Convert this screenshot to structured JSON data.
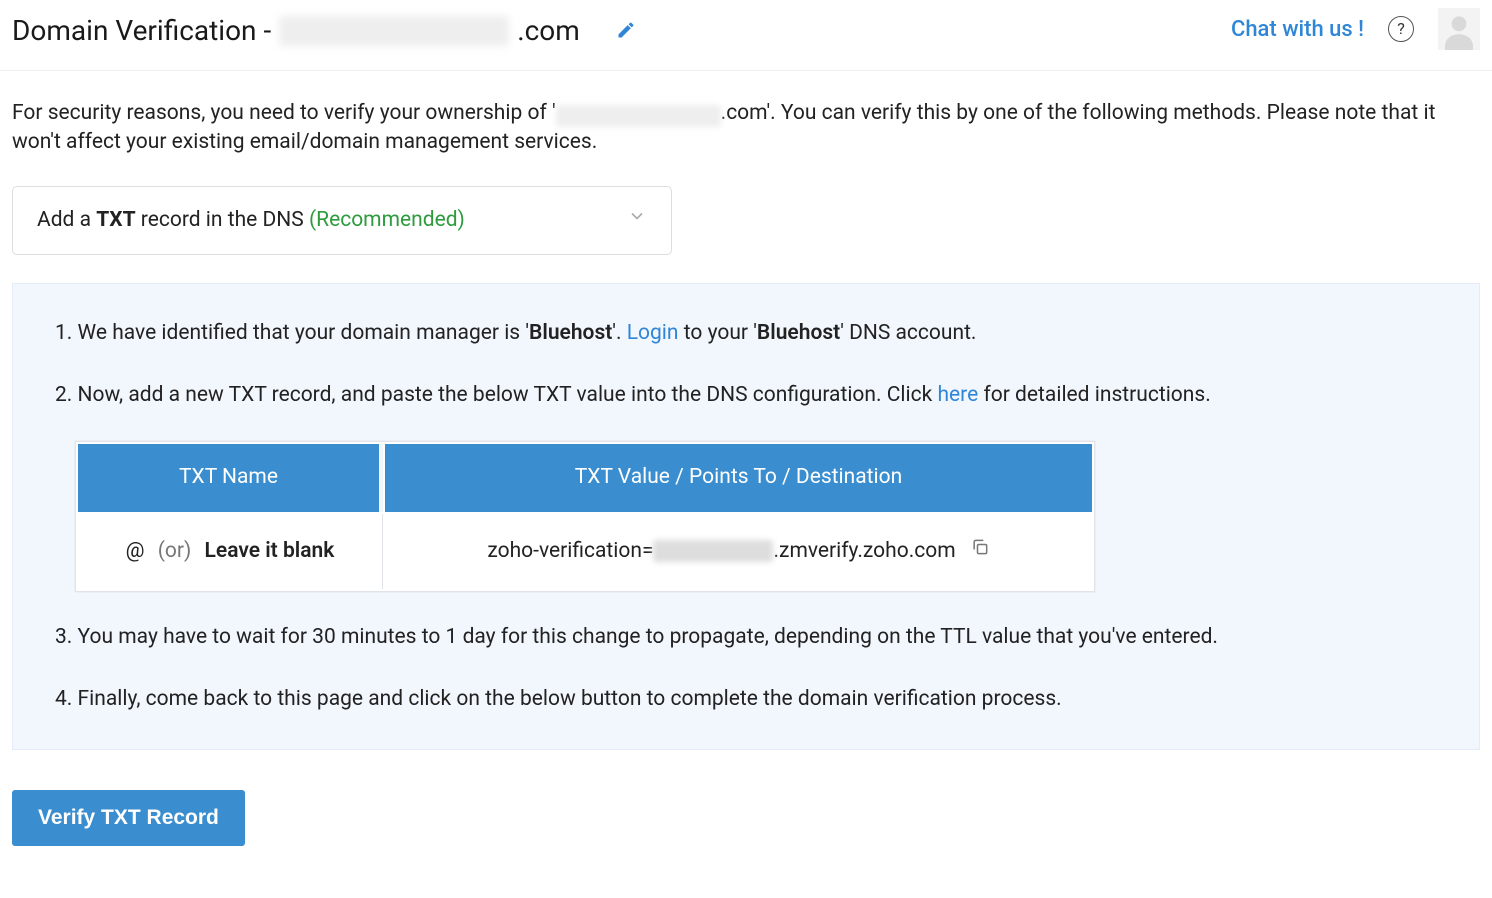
{
  "header": {
    "title_prefix": "Domain Verification - ",
    "domain_redacted": true,
    "title_suffix": ".com",
    "chat_link": "Chat with us !"
  },
  "description": {
    "pre": "For security reasons, you need to verify your ownership of '",
    "mid_redacted": true,
    "post1": ".com'. You can verify this by one of the following methods. Please note that it won't affect your existing email/domain management services."
  },
  "method": {
    "label_pre": "Add a ",
    "label_bold": "TXT",
    "label_post": " record in the DNS ",
    "recommended": "(Recommended)"
  },
  "steps": {
    "s1_pre": "1. We have identified that your domain manager is '",
    "s1_bluehost": "Bluehost",
    "s1_mid": "'. ",
    "s1_login": "Login",
    "s1_post": " to your '",
    "s1_bluehost2": "Bluehost",
    "s1_end": "' DNS account.",
    "s2_pre": "2. Now, add a new TXT record, and paste the below TXT value into the DNS configuration. Click ",
    "s2_here": "here",
    "s2_post": " for detailed instructions.",
    "s3": "3. You may have to wait for 30 minutes to 1 day for this change to propagate, depending on the TTL value that you've entered.",
    "s4": "4. Finally, come back to this page and click on the below button to complete the domain verification process."
  },
  "table": {
    "col1": "TXT Name",
    "col2": "TXT Value / Points To / Destination",
    "name_at": "@",
    "name_or": "(or)",
    "name_blank": "Leave it blank",
    "value_pre": "zoho-verification=",
    "value_redacted": true,
    "value_post": ".zmverify.zoho.com"
  },
  "button": {
    "verify": "Verify TXT Record"
  }
}
